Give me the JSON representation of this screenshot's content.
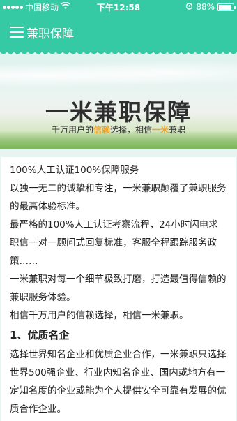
{
  "status_bar": {
    "carrier": "中国移动",
    "time": "下午12:58",
    "battery_percent": "88%",
    "battery_level": 0.88
  },
  "nav": {
    "title": "兼职保障"
  },
  "banner": {
    "title": "一米兼职保障",
    "subtitle_pre": "千万用户的",
    "subtitle_hl1": "信赖",
    "subtitle_mid": "选择，相信",
    "subtitle_hl2": "一米",
    "subtitle_post": "兼职"
  },
  "content": {
    "paragraphs": [
      "100%人工认证100%保障服务",
      "以独一无二的诚挚和专注，一米兼职颠覆了兼职服务的最高体验标准。",
      "最严格的100%人工认证考察流程，24小时闪电求职信一对一顾问式回复标准，客服全程跟踪服务政策……",
      "一米兼职对每一个细节极致打磨，打造最值得信赖的兼职服务体验。",
      "相信千万用户的信赖选择，相信一米兼职。"
    ],
    "section1_title": "1、优质名企",
    "section1_body": "选择世界知名企业和优质企业合作，一米兼职只选择世界500强企业、行业内知名企业、国内或地方有一定知名度的企业或能为个人提供安全可靠有发展的优质合作企业。"
  }
}
